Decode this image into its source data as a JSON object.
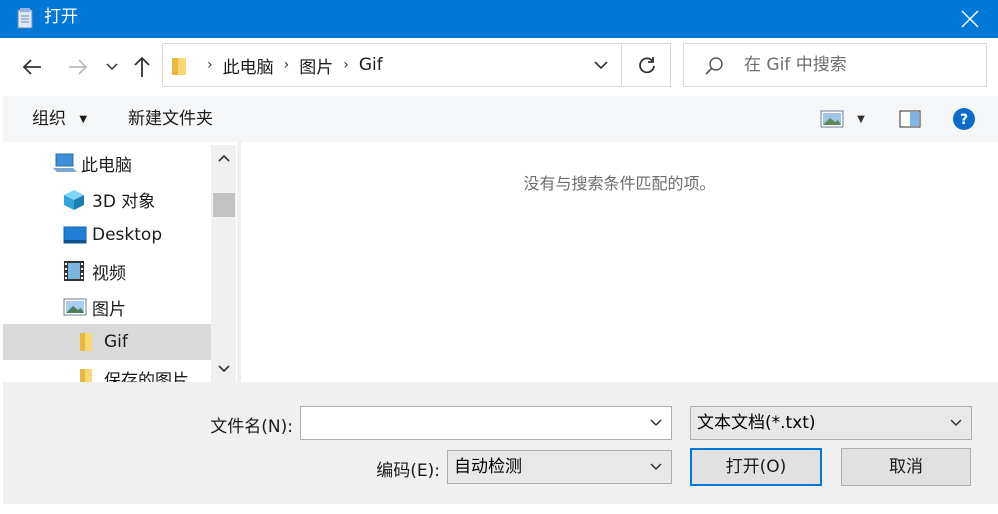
{
  "window": {
    "title": "打开"
  },
  "address": {
    "crumbs": [
      "此电脑",
      "图片",
      "Gif"
    ]
  },
  "search": {
    "placeholder": "在 Gif 中搜索"
  },
  "toolbar": {
    "organize": "组织",
    "new_folder": "新建文件夹"
  },
  "tree": {
    "items": [
      {
        "label": "此电脑",
        "icon": "computer-icon"
      },
      {
        "label": "3D 对象",
        "icon": "3d-objects-icon"
      },
      {
        "label": "Desktop",
        "icon": "desktop-icon"
      },
      {
        "label": "视频",
        "icon": "video-icon"
      },
      {
        "label": "图片",
        "icon": "pictures-icon"
      },
      {
        "label": "Gif",
        "icon": "folder-icon",
        "selected": true
      },
      {
        "label": "保存的图片",
        "icon": "folder-icon"
      }
    ]
  },
  "content": {
    "empty_message": "没有与搜索条件匹配的项。"
  },
  "form": {
    "filename_label": "文件名(N):",
    "filename_value": "",
    "filetype_value": "文本文档(*.txt)",
    "encoding_label": "编码(E):",
    "encoding_value": "自动检测",
    "open_button": "打开(O)",
    "cancel_button": "取消"
  },
  "colors": {
    "titlebar": "#0078d7",
    "selected": "#d9d9d9",
    "accent": "#0078d7"
  }
}
